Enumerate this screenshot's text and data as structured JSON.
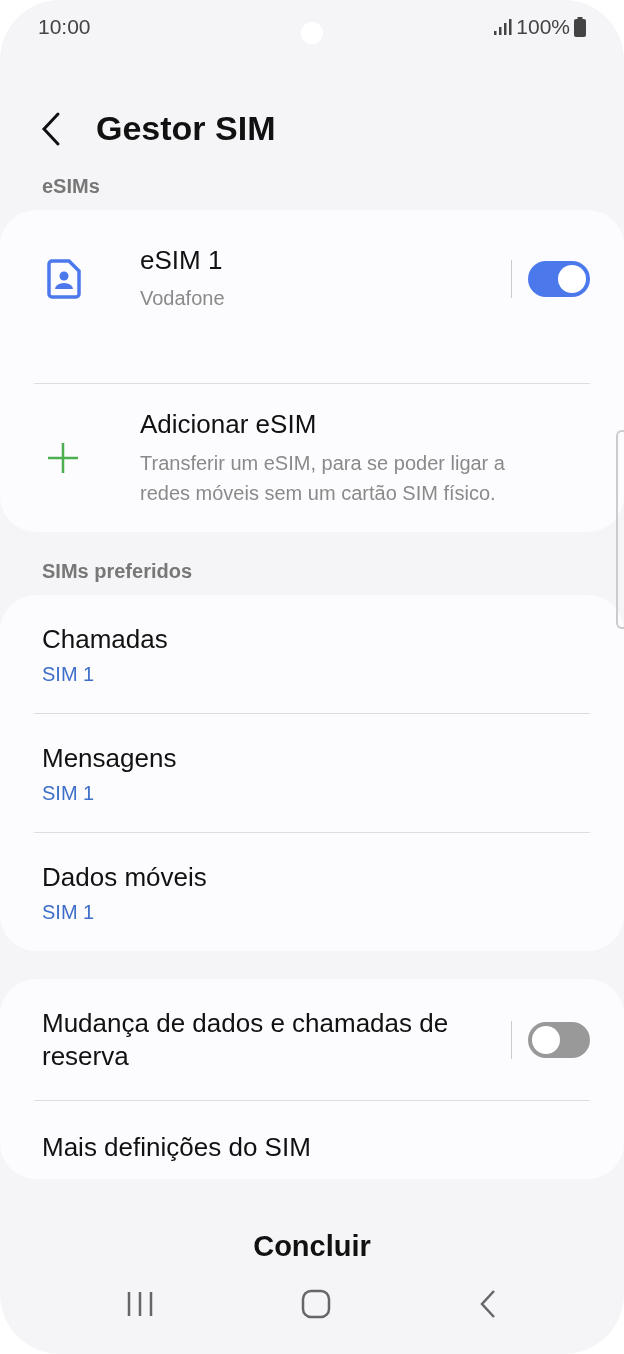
{
  "status_bar": {
    "time": "10:00",
    "battery": "100%"
  },
  "header": {
    "title": "Gestor SIM"
  },
  "sections": [
    {
      "label": "eSIMs",
      "items": [
        {
          "kind": "sim",
          "title": "eSIM 1",
          "subtitle": "Vodafone",
          "on": true
        },
        {
          "kind": "add",
          "title": "Adicionar eSIM",
          "subtitle": "Transferir um eSIM, para se poder ligar a redes móveis sem um cartão SIM físico."
        }
      ]
    },
    {
      "label": "SIMs preferidos",
      "items": [
        {
          "kind": "pref",
          "title": "Chamadas",
          "value": "SIM 1"
        },
        {
          "kind": "pref",
          "title": "Mensagens",
          "value": "SIM 1"
        },
        {
          "kind": "pref",
          "title": "Dados móveis",
          "value": "SIM 1"
        }
      ]
    },
    {
      "items": [
        {
          "kind": "switch",
          "title": "Mudança de dados e chamadas de reserva",
          "on": false
        },
        {
          "kind": "plain",
          "title": "Mais definições do SIM"
        }
      ]
    }
  ],
  "footer": {
    "button": "Concluir"
  }
}
